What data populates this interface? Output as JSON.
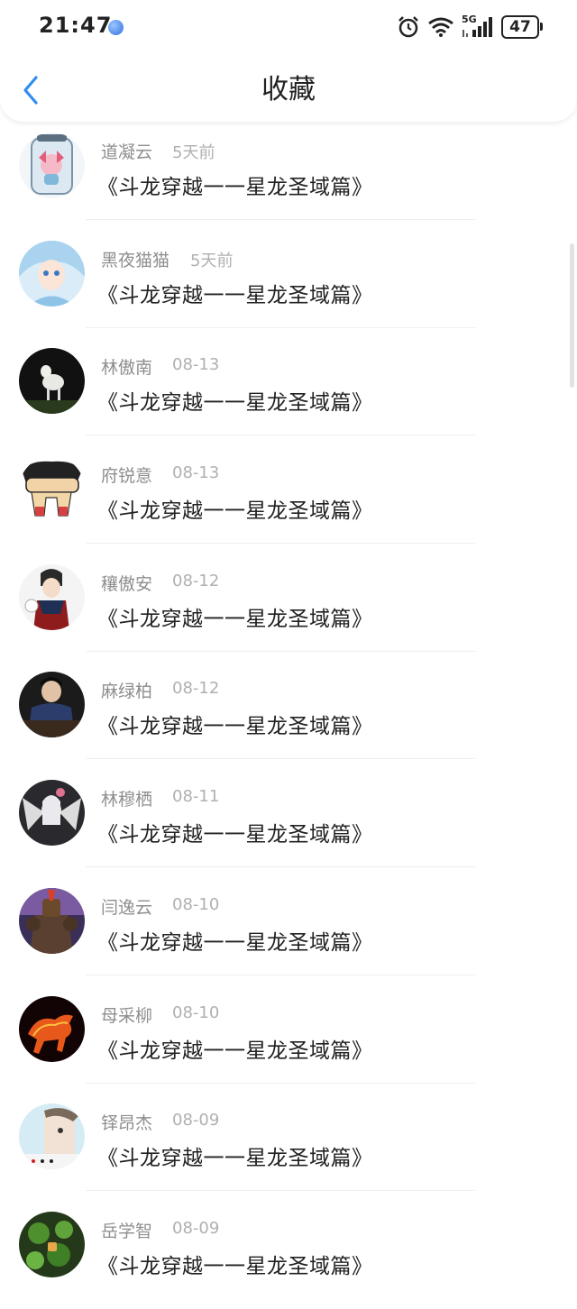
{
  "status_bar": {
    "time": "21:47",
    "network": "5G",
    "battery": "47",
    "icons": [
      "alarm-icon",
      "wifi-icon",
      "signal-icon",
      "battery-icon"
    ]
  },
  "header": {
    "title": "收藏",
    "back_icon": "chevron-left-icon",
    "accent_color": "#2f8ef0"
  },
  "items": [
    {
      "user": "道凝云",
      "time": "5天前",
      "title": "《斗龙穿越一一星龙圣域篇》"
    },
    {
      "user": "黑夜猫猫",
      "time": "5天前",
      "title": "《斗龙穿越一一星龙圣域篇》"
    },
    {
      "user": "林傲南",
      "time": "08-13",
      "title": "《斗龙穿越一一星龙圣域篇》"
    },
    {
      "user": "府锐意",
      "time": "08-13",
      "title": "《斗龙穿越一一星龙圣域篇》"
    },
    {
      "user": "穰傲安",
      "time": "08-12",
      "title": "《斗龙穿越一一星龙圣域篇》"
    },
    {
      "user": "麻绿柏",
      "time": "08-12",
      "title": "《斗龙穿越一一星龙圣域篇》"
    },
    {
      "user": "林穆栖",
      "time": "08-11",
      "title": "《斗龙穿越一一星龙圣域篇》"
    },
    {
      "user": "闫逸云",
      "time": "08-10",
      "title": "《斗龙穿越一一星龙圣域篇》"
    },
    {
      "user": "母采柳",
      "time": "08-10",
      "title": "《斗龙穿越一一星龙圣域篇》"
    },
    {
      "user": "铎昂杰",
      "time": "08-09",
      "title": "《斗龙穿越一一星龙圣域篇》"
    },
    {
      "user": "岳学智",
      "time": "08-09",
      "title": "《斗龙穿越一一星龙圣域篇》"
    }
  ]
}
